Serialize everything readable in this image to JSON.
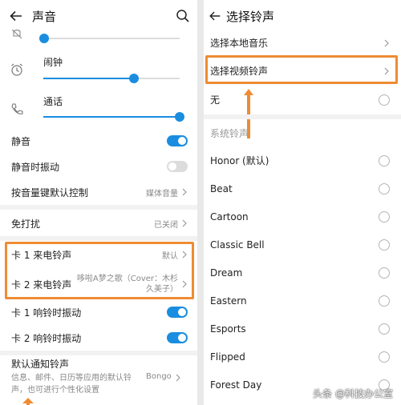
{
  "left": {
    "title": "声音",
    "volume": {
      "alarm_label": "闹钟",
      "call_label": "通话",
      "ring_level": 0.0,
      "alarm_level": 0.66,
      "call_level": 1.0
    },
    "rows": {
      "mute": "静音",
      "vibrate_on_mute": "静音时振动",
      "volume_key": "按音量键默认控制",
      "volume_key_value": "媒体音量",
      "dnd": "免打扰",
      "dnd_value": "已关闭",
      "card1_ringtone": "卡 1 来电铃声",
      "card1_ringtone_value": "默认",
      "card2_ringtone": "卡 2 来电铃声",
      "card2_ringtone_value": "哆啦A梦之歌（Cover：木杉久美子）",
      "card1_vibrate": "卡 1 响铃时振动",
      "card2_vibrate": "卡 2 响铃时振动",
      "notif_title": "默认通知铃声",
      "notif_desc": "信息、邮件、日历等应用的默认铃声，也可进行个性化设置",
      "notif_value": "Bongo"
    },
    "toggles": {
      "mute": true,
      "vibrate_on_mute": false,
      "card1_vibrate": true,
      "card2_vibrate": true
    }
  },
  "right": {
    "title": "选择铃声",
    "local_music": "选择本地音乐",
    "video_ringtone": "选择视频铃声",
    "none": "无",
    "system_section": "系统铃声",
    "ringtones": [
      "Honor (默认)",
      "Beat",
      "Cartoon",
      "Classic Bell",
      "Dream",
      "Eastern",
      "Esports",
      "Flipped",
      "Forest Day"
    ]
  },
  "watermark": "头条 @科技办公室",
  "colors": {
    "accent": "#1a8de0",
    "highlight": "#ee8c33"
  }
}
